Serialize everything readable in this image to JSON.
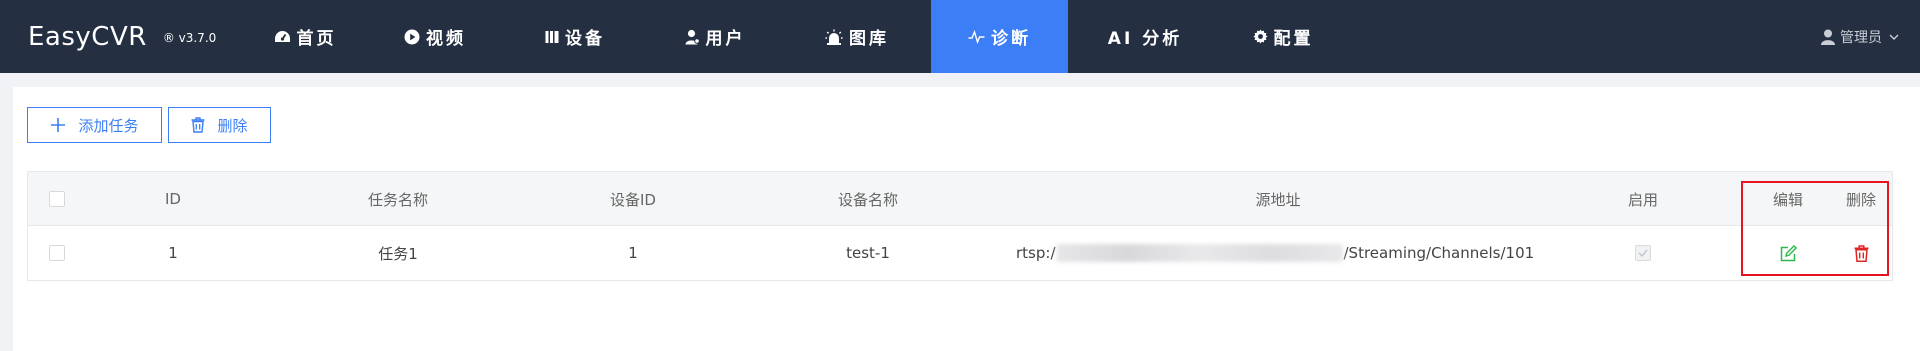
{
  "app": {
    "name": "EasyCVR",
    "version": "® v3.7.0"
  },
  "nav": [
    {
      "label": "首页",
      "icon": "dashboard-icon"
    },
    {
      "label": "视频",
      "icon": "play-icon"
    },
    {
      "label": "设备",
      "icon": "device-icon"
    },
    {
      "label": "用户",
      "icon": "user-icon"
    },
    {
      "label": "图库",
      "icon": "alarm-icon"
    },
    {
      "label": "诊断",
      "icon": "pulse-icon",
      "active": true
    },
    {
      "label": "AI 分析",
      "icon": ""
    },
    {
      "label": "配置",
      "icon": "gear-icon"
    }
  ],
  "user": {
    "name": "管理员"
  },
  "toolbar": {
    "add_label": "添加任务",
    "delete_label": "删除"
  },
  "table": {
    "headers": [
      "ID",
      "任务名称",
      "设备ID",
      "设备名称",
      "源地址",
      "启用",
      "编辑",
      "删除"
    ],
    "rows": [
      {
        "id": "1",
        "task_name": "任务1",
        "device_id": "1",
        "device_name": "test-1",
        "source_prefix": "rtsp:/",
        "source_suffix": "/Streaming/Channels/101",
        "enabled": true
      }
    ]
  },
  "colors": {
    "nav_bg": "#242f42",
    "accent": "#3c7ef6",
    "edit": "#2db84d",
    "delete": "#e02424",
    "highlight": "#e8131f"
  }
}
